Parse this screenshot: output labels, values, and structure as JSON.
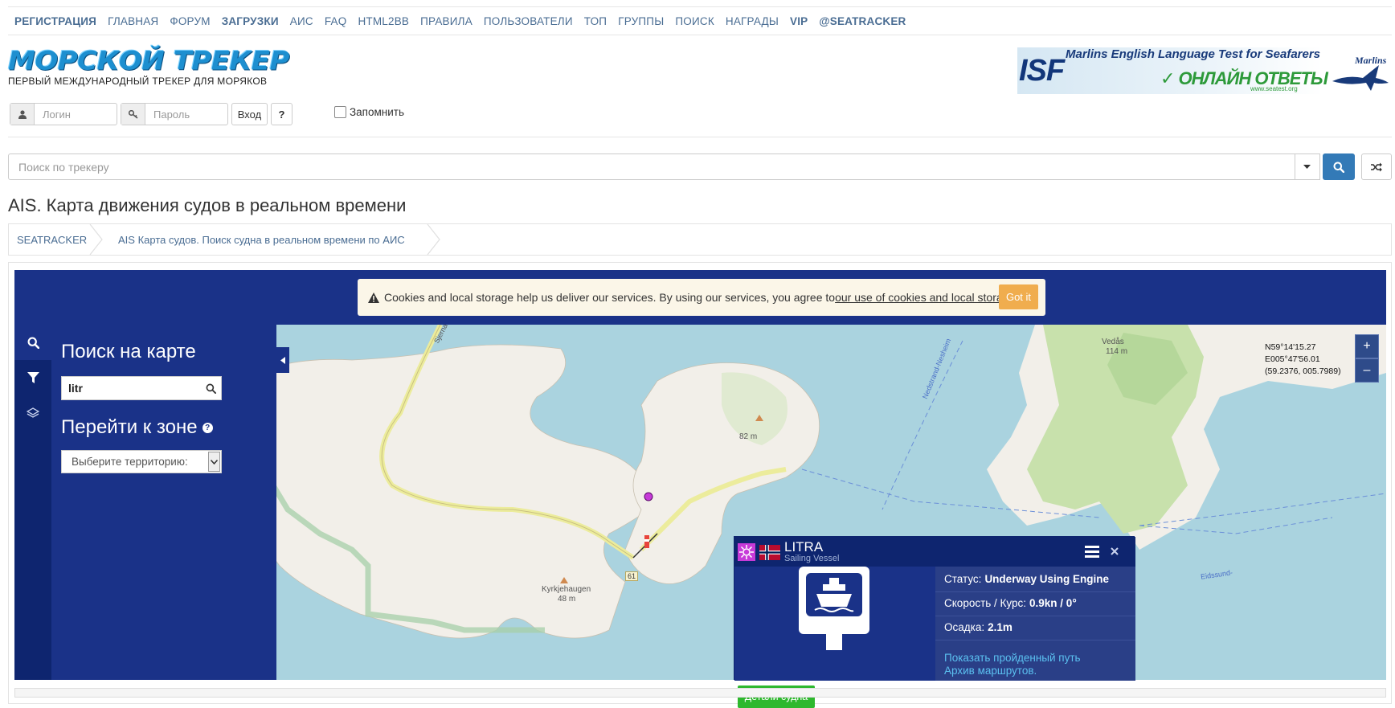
{
  "nav": {
    "items": [
      {
        "label": "РЕГИСТРАЦИЯ",
        "bold": true
      },
      {
        "label": "ГЛАВНАЯ",
        "bold": false
      },
      {
        "label": "ФОРУМ",
        "bold": false
      },
      {
        "label": "ЗАГРУЗКИ",
        "bold": true
      },
      {
        "label": "АИС",
        "bold": false
      },
      {
        "label": "FAQ",
        "bold": false
      },
      {
        "label": "HTML2BB",
        "bold": false
      },
      {
        "label": "ПРАВИЛА",
        "bold": false
      },
      {
        "label": "ПОЛЬЗОВАТЕЛИ",
        "bold": false
      },
      {
        "label": "ТОП",
        "bold": false
      },
      {
        "label": "ГРУППЫ",
        "bold": false
      },
      {
        "label": "ПОИСК",
        "bold": false
      },
      {
        "label": "НАГРАДЫ",
        "bold": false
      },
      {
        "label": "VIP",
        "bold": true
      },
      {
        "label": "@SEATRACKER",
        "bold": true
      }
    ]
  },
  "header": {
    "logo_title": "МОРСКОЙ ТРЕКЕР",
    "logo_subtitle": "ПЕРВЫЙ МЕЖДУНАРОДНЫЙ ТРЕКЕР ДЛЯ МОРЯКОВ",
    "banner": {
      "title": "Marlins English Language Test for Seafarers",
      "isf": "ISF",
      "online": "ОНЛАЙН ОТВЕТЫ",
      "site": "www.seatest.org",
      "marlins": "Marlins"
    }
  },
  "login": {
    "login_placeholder": "Логин",
    "password_placeholder": "Пароль",
    "login_button": "Вход",
    "help_button": "?",
    "remember_label": "Запомнить"
  },
  "search": {
    "placeholder": "Поиск по трекеру"
  },
  "page_title": "AIS. Карта движения судов в реальном времени",
  "breadcrumb": {
    "items": [
      "SEATRACKER",
      "AIS Карта судов. Поиск судна в реальном времени по АИС"
    ]
  },
  "cookie": {
    "text": "Cookies and local storage help us deliver our services. By using our services, you agree to ",
    "link": "our use of cookies and local storage",
    "suffix": ".",
    "button": "Got it"
  },
  "sidebar": {
    "search_title": "Поиск на карте",
    "search_value": "litr",
    "zone_title": "Перейти к зоне",
    "zone_placeholder": "Выберите территорию:"
  },
  "map": {
    "coords": [
      "N59°14'15.27",
      "E005°47'56.01",
      "(59.2376, 005.7989)"
    ],
    "zoom_in": "+",
    "zoom_out": "–",
    "labels": {
      "road": "Sjernarøybrua",
      "channel": "Nedstrand-Nesheim",
      "peak1": "82 m",
      "vedas": "Vedås",
      "vedas_h": "114 m",
      "kyrk": "Kyrkjehaugen",
      "kyrk_h": "48 m",
      "road_no": "61",
      "eidssund": "Eidssund-"
    }
  },
  "vessel": {
    "name": "LITRA",
    "type": "Sailing Vessel",
    "status_label": "Статус:",
    "status_value": "Underway Using Engine",
    "speed_label": "Скорость / Курс:",
    "speed_value": "0.9kn / 0°",
    "draught_label": "Осадка:",
    "draught_value": "2.1m",
    "link_track": "Показать пройденный путь",
    "link_archive": "Архив маршрутов.",
    "details_button": "Детали судна"
  },
  "colors": {
    "nav_link": "#4a6d93",
    "panel": "#1a3288",
    "panel_dark": "#0e256f",
    "water": "#aad3df",
    "land": "#f2efe9",
    "forest": "#c8e1ac",
    "accent_button": "#337ab7",
    "got_it": "#f0ad4e",
    "details_green": "#2eb82e"
  }
}
